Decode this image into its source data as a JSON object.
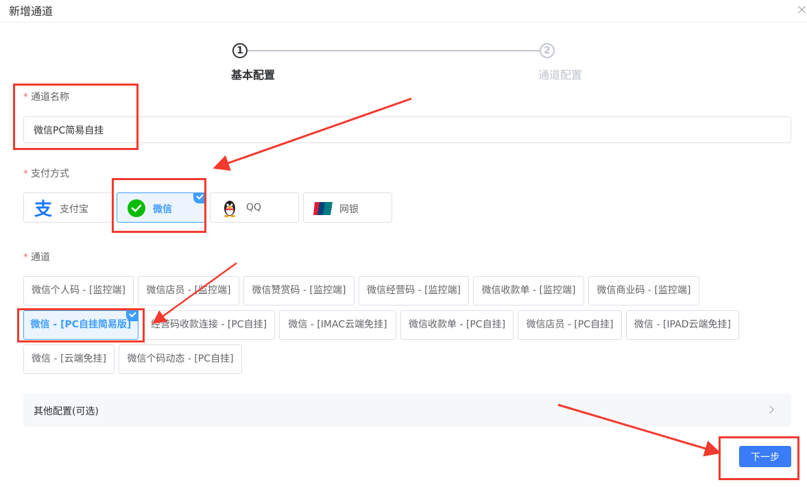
{
  "dialog": {
    "title": "新增通道"
  },
  "steps": [
    {
      "number": "1",
      "label": "基本配置"
    },
    {
      "number": "2",
      "label": "通道配置"
    }
  ],
  "form": {
    "name": {
      "required_mark": "*",
      "label": "通道名称",
      "value": "微信PC简易自挂"
    },
    "payment": {
      "required_mark": "*",
      "label": "支付方式",
      "options": [
        {
          "label": "支付宝",
          "icon": "alipay-icon"
        },
        {
          "label": "微信",
          "icon": "wechat-icon",
          "selected": true
        },
        {
          "label": "QQ",
          "icon": "qq-penguin-icon"
        },
        {
          "label": "网银",
          "icon": "unionpay-icon"
        }
      ]
    },
    "channel": {
      "required_mark": "*",
      "label": "通道",
      "options": [
        "微信个人码 - [监控端]",
        "微信店员 - [监控端]",
        "微信赞赏码 - [监控端]",
        "微信经营码 - [监控端]",
        "微信收款单 - [监控端]",
        "微信商业码 - [监控端]",
        "微信 - [PC自挂简易版]",
        "经营码收款连接 - [PC自挂]",
        "微信 - [IMAC云端免挂]",
        "微信收款单 - [PC自挂]",
        "微信店员 - [PC自挂]",
        "微信 - [IPAD云端免挂]",
        "微信 - [云端免挂]",
        "微信个码动态 - [PC自挂]"
      ],
      "selected_index": 6
    }
  },
  "other_config": {
    "label": "其他配置(可选)"
  },
  "next_button": {
    "label": "下一步"
  },
  "colors": {
    "primary": "#409eff",
    "button": "#3a7cf5",
    "annotation_red": "#f23a2e",
    "required": "#f56c6c",
    "wechat_green": "#09bb07",
    "alipay_blue": "#1677ff"
  }
}
